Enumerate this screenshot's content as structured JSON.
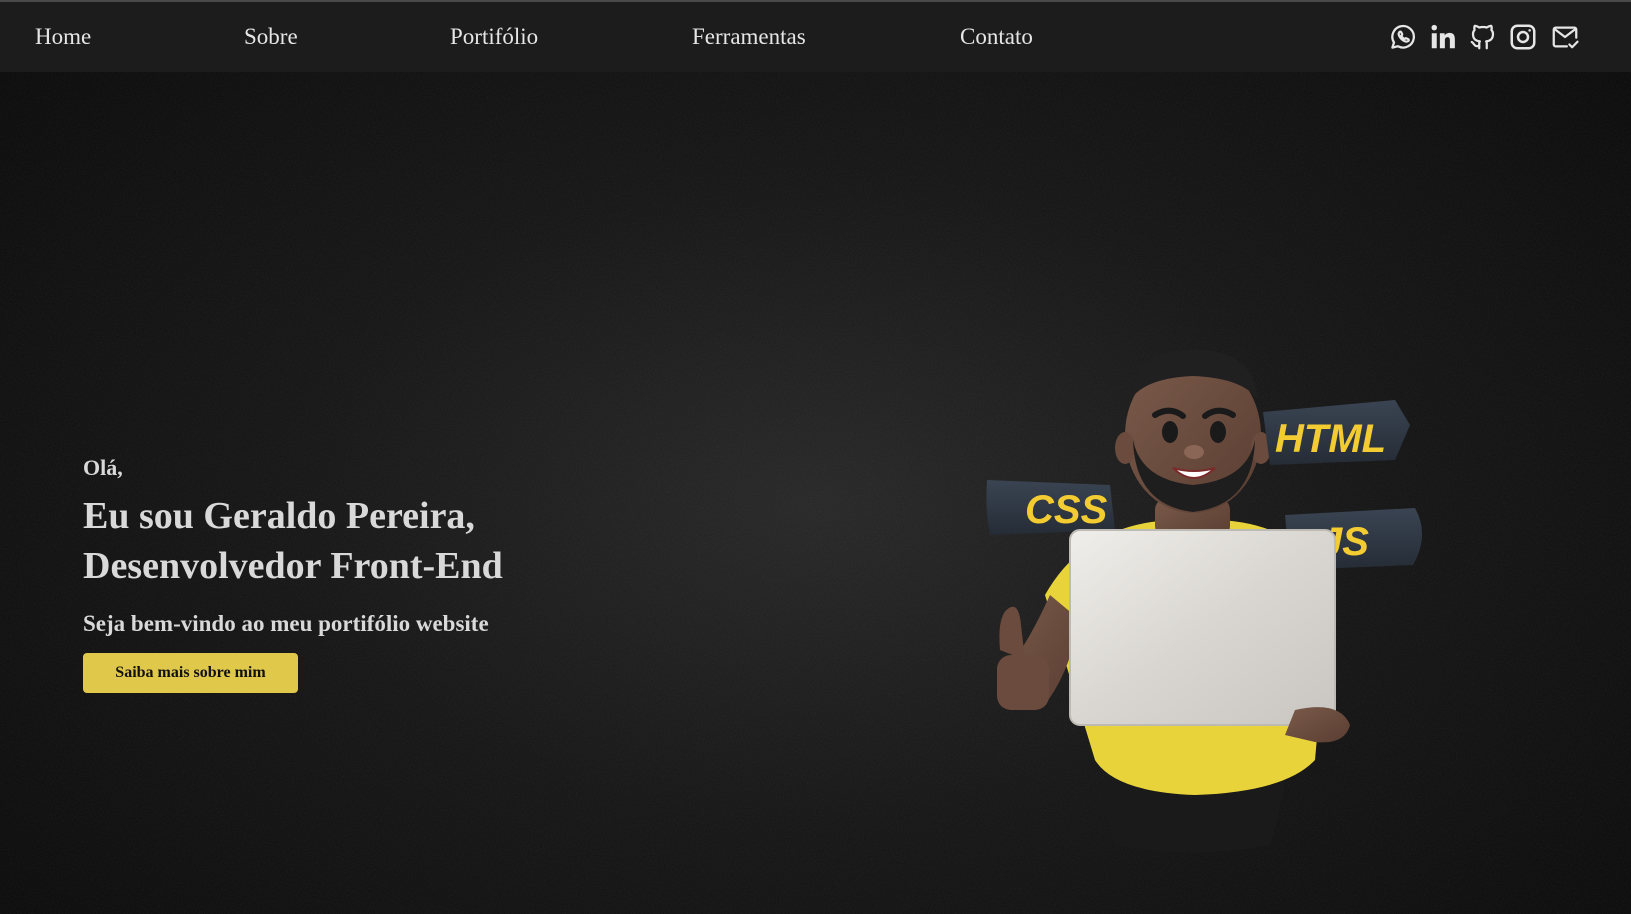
{
  "nav": {
    "links": [
      "Home",
      "Sobre",
      "Portifólio",
      "Ferramentas",
      "Contato"
    ],
    "social_icons": [
      "whatsapp-icon",
      "linkedin-icon",
      "github-icon",
      "instagram-icon",
      "mail-icon"
    ]
  },
  "hero": {
    "greeting": "Olá,",
    "headline": "Eu sou Geraldo Pereira, Desenvolvedor Front-End",
    "tagline": "Seja bem-vindo ao meu portifólio website",
    "cta_label": "Saiba mais sobre mim"
  },
  "illustration": {
    "tags": [
      "HTML",
      "CSS",
      "JS"
    ]
  },
  "colors": {
    "navbar_bg": "#1c1c1c",
    "accent": "#e0c84a",
    "text": "#d9d9d9",
    "background": "#111111"
  }
}
